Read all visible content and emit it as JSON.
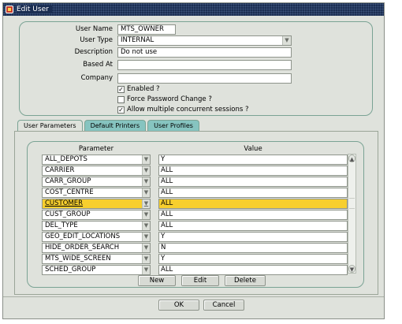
{
  "window": {
    "title": "Edit User"
  },
  "form": {
    "user_name_label": "User Name",
    "user_name_value": "MTS_OWNER",
    "user_type_label": "User Type",
    "user_type_value": "INTERNAL",
    "description_label": "Description",
    "description_value": "Do not use",
    "based_at_label": "Based At",
    "based_at_value": "",
    "company_label": "Company",
    "company_value": "",
    "enabled_label": "Enabled ?",
    "enabled_checked": true,
    "force_pw_label": "Force Password Change ?",
    "force_pw_checked": false,
    "multi_sessions_label": "Allow multiple concurrent sessions ?",
    "multi_sessions_checked": true
  },
  "tabs": [
    {
      "label": "User Parameters",
      "active": true
    },
    {
      "label": "Default Printers",
      "active": false
    },
    {
      "label": "User Profiles",
      "active": false
    }
  ],
  "grid": {
    "col_parameter": "Parameter",
    "col_value": "Value",
    "rows": [
      {
        "parameter": "ALL_DEPOTS",
        "value": "Y"
      },
      {
        "parameter": "CARRIER",
        "value": "ALL"
      },
      {
        "parameter": "CARR_GROUP",
        "value": "ALL"
      },
      {
        "parameter": "COST_CENTRE",
        "value": "ALL"
      },
      {
        "parameter": "CUSTOMER",
        "value": "ALL",
        "selected": true
      },
      {
        "parameter": "CUST_GROUP",
        "value": "ALL"
      },
      {
        "parameter": "DEL_TYPE",
        "value": "ALL"
      },
      {
        "parameter": "GEO_EDIT_LOCATIONS",
        "value": "Y"
      },
      {
        "parameter": "HIDE_ORDER_SEARCH",
        "value": "N"
      },
      {
        "parameter": "MTS_WIDE_SCREEN",
        "value": "Y"
      },
      {
        "parameter": "SCHED_GROUP",
        "value": "ALL"
      }
    ]
  },
  "buttons": {
    "new": "New",
    "edit": "Edit",
    "delete": "Delete",
    "ok": "OK",
    "cancel": "Cancel"
  },
  "colors": {
    "title_bar": "#1b2e52",
    "selected_row": "#f7cf2e",
    "tab_inactive": "#86c4c0",
    "panel_border": "#7aa394"
  }
}
